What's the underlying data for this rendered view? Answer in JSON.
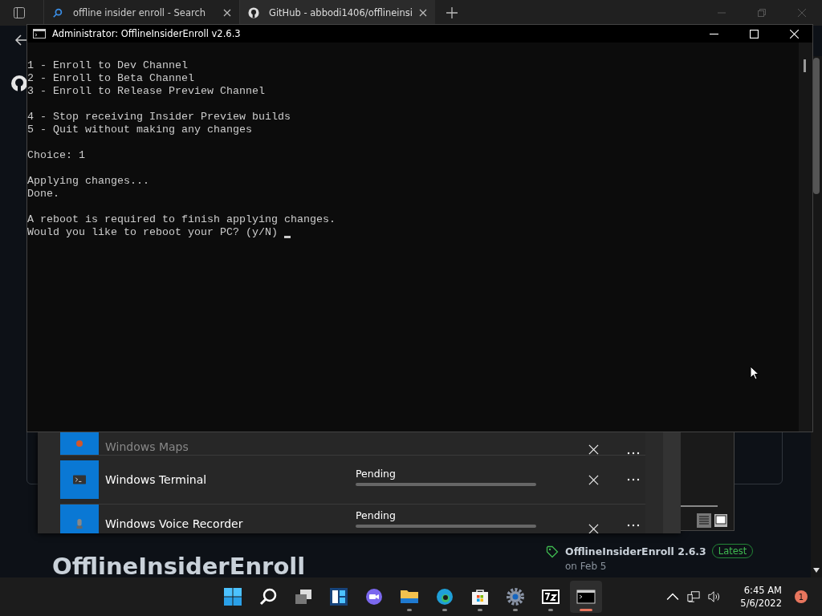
{
  "browser": {
    "tabs": [
      {
        "label": "offline insider enroll - Search",
        "kind": "search",
        "selected": false
      },
      {
        "label": "GitHub - abbodi1406/offlineinsi",
        "kind": "github",
        "selected": true
      }
    ]
  },
  "console": {
    "title": "Administrator:  OfflineInsiderEnroll v2.6.3",
    "blocks": [
      [
        "1 - Enroll to Dev Channel",
        "2 - Enroll to Beta Channel",
        "3 - Enroll to Release Preview Channel"
      ],
      [
        "4 - Stop receiving Insider Preview builds",
        "5 - Quit without making any changes"
      ],
      [
        "Choice: 1"
      ],
      [
        "Applying changes...",
        "Done."
      ],
      [
        "A reboot is required to finish applying changes.",
        "Would you like to reboot your PC? (y/N)"
      ]
    ]
  },
  "downloads": [
    {
      "name": "Windows Maps",
      "kind": "maps"
    },
    {
      "name": "Windows Terminal",
      "kind": "terminal",
      "status": "Pending"
    },
    {
      "name": "Windows Voice Recorder",
      "kind": "recorder",
      "status": "Pending"
    }
  ],
  "release": {
    "title": "OfflineInsiderEnroll 2.6.3",
    "badge": "Latest",
    "date": "on Feb 5"
  },
  "repo_heading": "OfflineInsiderEnroll",
  "taskbar": {
    "apps": [
      {
        "kind": "start",
        "running": false,
        "selected": false
      },
      {
        "kind": "search",
        "running": false,
        "selected": false
      },
      {
        "kind": "taskview",
        "running": false,
        "selected": false
      },
      {
        "kind": "widgets",
        "running": false,
        "selected": false
      },
      {
        "kind": "chat",
        "running": false,
        "selected": false
      },
      {
        "kind": "explorer",
        "running": true,
        "selected": false
      },
      {
        "kind": "edge",
        "running": true,
        "selected": false
      },
      {
        "kind": "store",
        "running": true,
        "selected": false
      },
      {
        "kind": "settings",
        "running": true,
        "selected": false
      },
      {
        "kind": "sevenzip",
        "running": true,
        "selected": false
      },
      {
        "kind": "console",
        "running": true,
        "selected": true
      }
    ],
    "time": "6:45 AM",
    "date": "5/6/2022",
    "notifications": "1"
  }
}
